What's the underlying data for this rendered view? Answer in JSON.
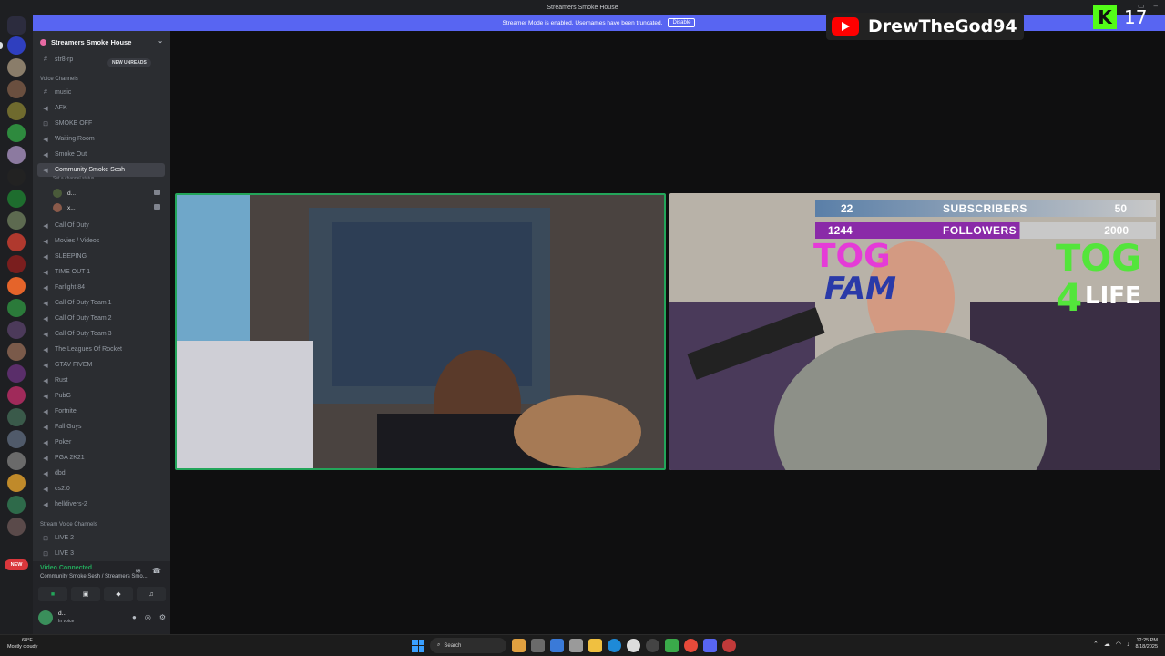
{
  "window": {
    "title": "Streamers Smoke House",
    "streamer_bar_text": "Streamer Mode is enabled. Usernames have been truncated.",
    "streamer_bar_button": "Disable"
  },
  "guild": {
    "name": "Streamers Smoke House",
    "new_unreads": "NEW UNREADS",
    "text_channel": "str8-rp",
    "voice_category": "Voice Channels",
    "stream_category": "Stream Voice Channels",
    "active_status": "Set a channel status",
    "new_badge": "NEW"
  },
  "channels": [
    {
      "label": "music",
      "icon": "hash"
    },
    {
      "label": "AFK",
      "icon": "speaker"
    },
    {
      "label": "SMOKE OFF",
      "icon": "lock"
    },
    {
      "label": "Waiting Room",
      "icon": "speaker"
    },
    {
      "label": "Smoke Out",
      "icon": "speaker"
    },
    {
      "label": "Community Smoke Sesh",
      "icon": "speaker"
    },
    {
      "label": "Call Of Duty",
      "icon": "speaker"
    },
    {
      "label": "Movies / Videos",
      "icon": "speaker"
    },
    {
      "label": "SLEEPING",
      "icon": "speaker"
    },
    {
      "label": "TIME OUT 1",
      "icon": "speaker"
    },
    {
      "label": "Farlight 84",
      "icon": "speaker"
    },
    {
      "label": "Call Of Duty Team 1",
      "icon": "speaker"
    },
    {
      "label": "Call Of Duty Team 2",
      "icon": "speaker"
    },
    {
      "label": "Call Of Duty Team 3",
      "icon": "speaker"
    },
    {
      "label": "The Leagues Of Rocket",
      "icon": "speaker"
    },
    {
      "label": "GTAV FIVEM",
      "icon": "speaker"
    },
    {
      "label": "Rust",
      "icon": "speaker"
    },
    {
      "label": "PubG",
      "icon": "speaker"
    },
    {
      "label": "Fortnite",
      "icon": "speaker"
    },
    {
      "label": "Fall Guys",
      "icon": "speaker"
    },
    {
      "label": "Poker",
      "icon": "speaker"
    },
    {
      "label": "PGA 2K21",
      "icon": "speaker"
    },
    {
      "label": "dbd",
      "icon": "speaker"
    },
    {
      "label": "cs2.0",
      "icon": "speaker"
    },
    {
      "label": "helldivers-2",
      "icon": "speaker"
    },
    {
      "label": "LIVE 2",
      "icon": "lock"
    },
    {
      "label": "LIVE 3",
      "icon": "lock"
    }
  ],
  "voice_users": [
    {
      "name": "d..."
    },
    {
      "name": "x..."
    }
  ],
  "voice_panel": {
    "title": "Video Connected",
    "subtitle": "Community Smoke Sesh / Streamers Smo..."
  },
  "user": {
    "name": "d...",
    "status": "In voice"
  },
  "overlay": {
    "subs_current": "22",
    "subs_label": "SUBSCRIBERS",
    "subs_goal": "50",
    "followers_current": "1244",
    "followers_label": "FOLLOWERS",
    "followers_goal": "2000",
    "tog_fam_1": "TOG",
    "tog_fam_2": "FAM",
    "tog_life_1": "TOG",
    "tog_life_2": "4",
    "tog_life_3": "LIFE"
  },
  "stream_badge": {
    "channel": "DrewTheGod94",
    "kick_count": "17"
  },
  "taskbar": {
    "temp": "68°F",
    "weather": "Mostly cloudy",
    "search": "Search",
    "time": "12:25 PM",
    "date": "8/18/2025"
  },
  "colors": {
    "accent": "#5865f2",
    "connected": "#23a55a",
    "kick": "#53fc18",
    "youtube": "#ff0000",
    "tog_pink": "#e53bd7",
    "tog_green": "#53e53b"
  }
}
